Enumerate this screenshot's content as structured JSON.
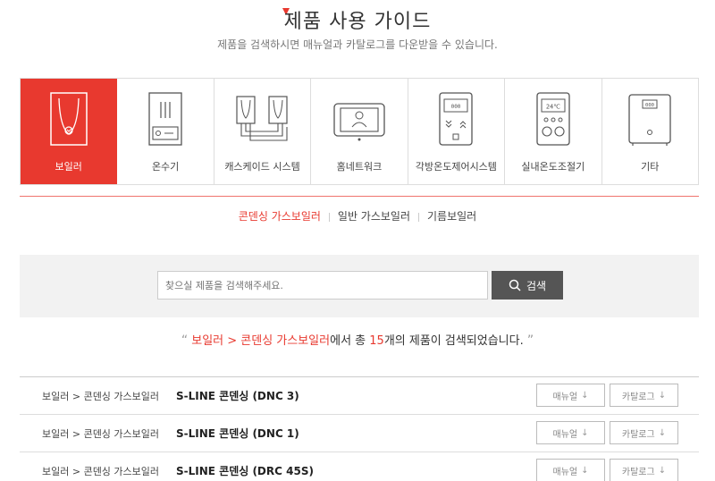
{
  "header": {
    "title": "제품 사용 가이드",
    "subtitle": "제품을 검색하시면 매뉴얼과 카탈로그를 다운받을 수 있습니다."
  },
  "categories": [
    {
      "label": "보일러",
      "icon": "boiler-icon",
      "active": true
    },
    {
      "label": "온수기",
      "icon": "water-heater-icon",
      "active": false
    },
    {
      "label": "캐스케이드 시스템",
      "icon": "cascade-system-icon",
      "active": false
    },
    {
      "label": "홈네트워크",
      "icon": "home-network-icon",
      "active": false
    },
    {
      "label": "각방온도제어시스템",
      "icon": "room-control-icon",
      "display": "000",
      "active": false
    },
    {
      "label": "실내온도조절기",
      "icon": "thermostat-icon",
      "display": "24℃",
      "active": false
    },
    {
      "label": "기타",
      "icon": "etc-device-icon",
      "display": "000",
      "active": false
    }
  ],
  "subtabs": [
    {
      "label": "콘덴싱 가스보일러",
      "active": true
    },
    {
      "label": "일반 가스보일러",
      "active": false
    },
    {
      "label": "기름보일러",
      "active": false
    }
  ],
  "search": {
    "placeholder": "찾으실 제품을 검색해주세요.",
    "button_label": "검색"
  },
  "result": {
    "open_quote": "“",
    "path": "보일러 > 콘덴싱 가스보일러",
    "middle": "에서 총 ",
    "count": "15",
    "end": "개의 제품이 검색되었습니다.",
    "close_quote": "”"
  },
  "products": [
    {
      "category": "보일러 > 콘덴싱 가스보일러",
      "name": "S-LINE 콘덴싱 (DNC 3)",
      "manual_label": "매뉴얼",
      "catalog_label": "카탈로그"
    },
    {
      "category": "보일러 > 콘덴싱 가스보일러",
      "name": "S-LINE 콘덴싱 (DNC 1)",
      "manual_label": "매뉴얼",
      "catalog_label": "카탈로그"
    },
    {
      "category": "보일러 > 콘덴싱 가스보일러",
      "name": "S-LINE 콘덴싱 (DRC 45S)",
      "manual_label": "매뉴얼",
      "catalog_label": "카탈로그"
    }
  ],
  "download_arrow": "↓",
  "colors": {
    "accent": "#e8392f",
    "button_dark": "#555555",
    "band": "#f2f2f2"
  }
}
